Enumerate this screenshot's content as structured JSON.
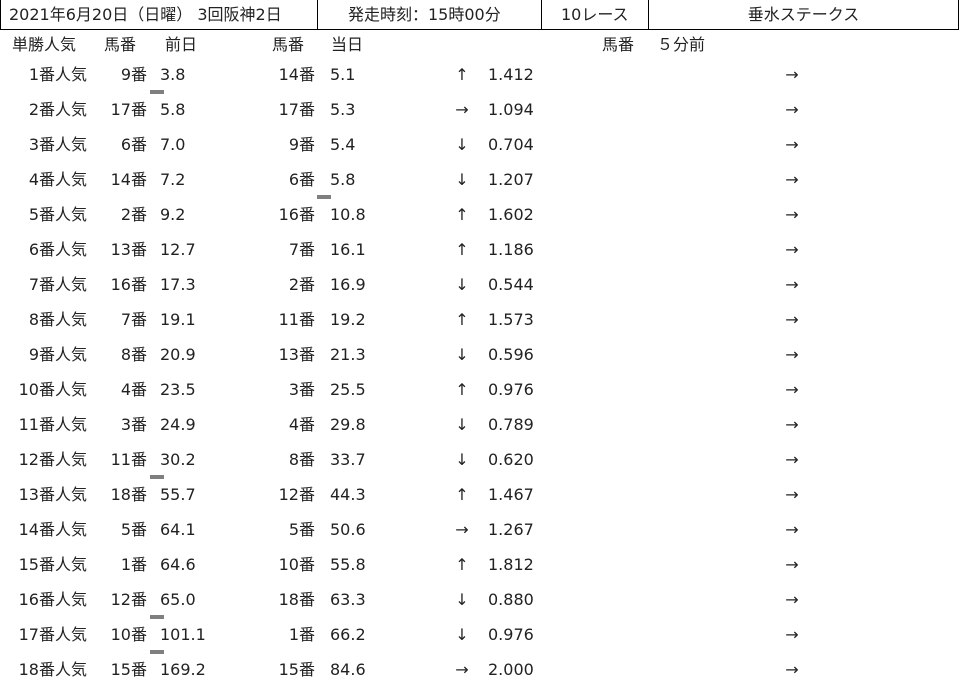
{
  "header": {
    "date_venue": "2021年6月20日（日曜） 3回阪神2日",
    "post_time": "発走時刻：15時00分",
    "race_no": "10レース",
    "race_name": "垂水ステークス"
  },
  "columns": {
    "popularity": "単勝人気",
    "horse_no_prev": "馬番",
    "prev_day": "前日",
    "horse_no_today": "馬番",
    "today": "当日",
    "horse_no_5min": "馬番",
    "five_min_before": "５分前"
  },
  "rows": [
    {
      "pop": "1番人気",
      "num1": "9番",
      "odds1": "3.8",
      "num2": "14番",
      "odds2": "5.1",
      "arrow": "↑",
      "ratio": "1.412",
      "arrow2": "→",
      "mark1": true,
      "mark2": false
    },
    {
      "pop": "2番人気",
      "num1": "17番",
      "odds1": "5.8",
      "num2": "17番",
      "odds2": "5.3",
      "arrow": "→",
      "ratio": "1.094",
      "arrow2": "→",
      "mark1": false,
      "mark2": false
    },
    {
      "pop": "3番人気",
      "num1": "6番",
      "odds1": "7.0",
      "num2": "9番",
      "odds2": "5.4",
      "arrow": "↓",
      "ratio": "0.704",
      "arrow2": "→",
      "mark1": false,
      "mark2": false
    },
    {
      "pop": "4番人気",
      "num1": "14番",
      "odds1": "7.2",
      "num2": "6番",
      "odds2": "5.8",
      "arrow": "↓",
      "ratio": "1.207",
      "arrow2": "→",
      "mark1": false,
      "mark2": true
    },
    {
      "pop": "5番人気",
      "num1": "2番",
      "odds1": "9.2",
      "num2": "16番",
      "odds2": "10.8",
      "arrow": "↑",
      "ratio": "1.602",
      "arrow2": "→",
      "mark1": false,
      "mark2": false
    },
    {
      "pop": "6番人気",
      "num1": "13番",
      "odds1": "12.7",
      "num2": "7番",
      "odds2": "16.1",
      "arrow": "↑",
      "ratio": "1.186",
      "arrow2": "→",
      "mark1": false,
      "mark2": false
    },
    {
      "pop": "7番人気",
      "num1": "16番",
      "odds1": "17.3",
      "num2": "2番",
      "odds2": "16.9",
      "arrow": "↓",
      "ratio": "0.544",
      "arrow2": "→",
      "mark1": false,
      "mark2": false
    },
    {
      "pop": "8番人気",
      "num1": "7番",
      "odds1": "19.1",
      "num2": "11番",
      "odds2": "19.2",
      "arrow": "↑",
      "ratio": "1.573",
      "arrow2": "→",
      "mark1": false,
      "mark2": false
    },
    {
      "pop": "9番人気",
      "num1": "8番",
      "odds1": "20.9",
      "num2": "13番",
      "odds2": "21.3",
      "arrow": "↓",
      "ratio": "0.596",
      "arrow2": "→",
      "mark1": false,
      "mark2": false
    },
    {
      "pop": "10番人気",
      "num1": "4番",
      "odds1": "23.5",
      "num2": "3番",
      "odds2": "25.5",
      "arrow": "↑",
      "ratio": "0.976",
      "arrow2": "→",
      "mark1": false,
      "mark2": false
    },
    {
      "pop": "11番人気",
      "num1": "3番",
      "odds1": "24.9",
      "num2": "4番",
      "odds2": "29.8",
      "arrow": "↓",
      "ratio": "0.789",
      "arrow2": "→",
      "mark1": false,
      "mark2": false
    },
    {
      "pop": "12番人気",
      "num1": "11番",
      "odds1": "30.2",
      "num2": "8番",
      "odds2": "33.7",
      "arrow": "↓",
      "ratio": "0.620",
      "arrow2": "→",
      "mark1": true,
      "mark2": false
    },
    {
      "pop": "13番人気",
      "num1": "18番",
      "odds1": "55.7",
      "num2": "12番",
      "odds2": "44.3",
      "arrow": "↑",
      "ratio": "1.467",
      "arrow2": "→",
      "mark1": false,
      "mark2": false
    },
    {
      "pop": "14番人気",
      "num1": "5番",
      "odds1": "64.1",
      "num2": "5番",
      "odds2": "50.6",
      "arrow": "→",
      "ratio": "1.267",
      "arrow2": "→",
      "mark1": false,
      "mark2": false
    },
    {
      "pop": "15番人気",
      "num1": "1番",
      "odds1": "64.6",
      "num2": "10番",
      "odds2": "55.8",
      "arrow": "↑",
      "ratio": "1.812",
      "arrow2": "→",
      "mark1": false,
      "mark2": false
    },
    {
      "pop": "16番人気",
      "num1": "12番",
      "odds1": "65.0",
      "num2": "18番",
      "odds2": "63.3",
      "arrow": "↓",
      "ratio": "0.880",
      "arrow2": "→",
      "mark1": true,
      "mark2": false
    },
    {
      "pop": "17番人気",
      "num1": "10番",
      "odds1": "101.1",
      "num2": "1番",
      "odds2": "66.2",
      "arrow": "↓",
      "ratio": "0.976",
      "arrow2": "→",
      "mark1": true,
      "mark2": false
    },
    {
      "pop": "18番人気",
      "num1": "15番",
      "odds1": "169.2",
      "num2": "15番",
      "odds2": "84.6",
      "arrow": "→",
      "ratio": "2.000",
      "arrow2": "→",
      "mark1": false,
      "mark2": false
    }
  ]
}
